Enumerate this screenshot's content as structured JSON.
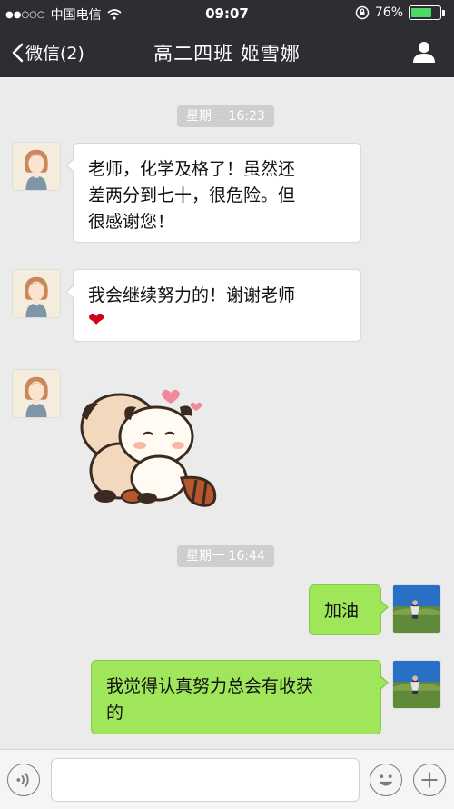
{
  "status_bar": {
    "signal": "●●○○○",
    "carrier": "中国电信",
    "time": "09:07",
    "battery": "76%",
    "battery_level": 0.76
  },
  "nav": {
    "back_label": "微信(2)",
    "title": "高二四班 姬雪娜"
  },
  "messages": {
    "time1": "星期一 16:23",
    "m1": [
      "老师，化学及格了！虽然还",
      "差两分到七十，很危险。但",
      "很感谢您！"
    ],
    "m2": "我会继续努力的！谢谢老师",
    "m2_emoji": "❤",
    "time2": "星期一 16:44",
    "m3": "加油",
    "m4": [
      "我觉得认真努力总会有收获",
      "的"
    ]
  },
  "input": {
    "placeholder": ""
  },
  "icons": {
    "voice": "voice-icon",
    "emoji": "emoji-icon",
    "plus": "plus-icon",
    "profile": "person-icon"
  },
  "colors": {
    "bar": "#2e2e32",
    "chat_bg": "#ebebeb",
    "bubble_out": "#9fe65a",
    "bubble_in": "#ffffff"
  }
}
